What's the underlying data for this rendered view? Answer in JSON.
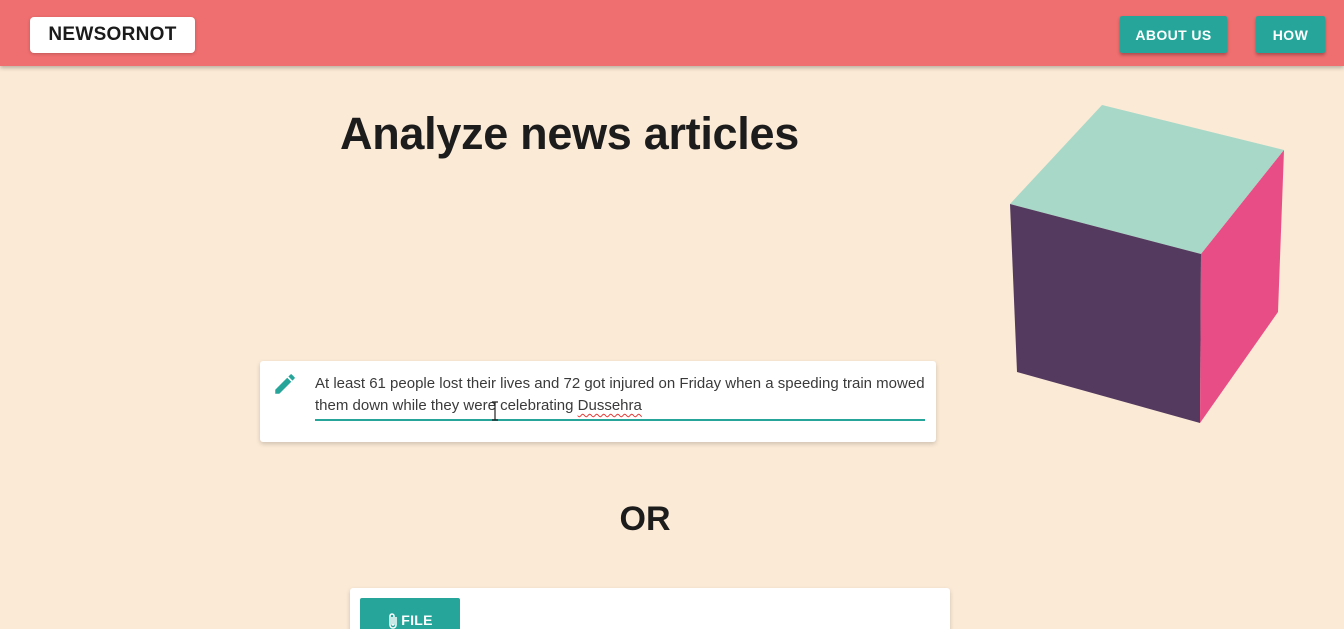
{
  "navbar": {
    "logo": "NEWSORNOT",
    "about_label": "ABOUT US",
    "how_label": "HOW"
  },
  "main": {
    "title": "Analyze news articles",
    "article_input": {
      "value_part1": "At least 61 people lost their lives and 72 got injured on Friday when a speeding train mowed them down while they were celebrating ",
      "value_misspelled": "Dussehra",
      "icon": "pencil-icon"
    },
    "or_label": "OR",
    "file_button_label": "FILE",
    "file_icon": "paperclip-icon"
  },
  "colors": {
    "navbar": "#ef6e6f",
    "background": "#fbead6",
    "accent": "#26a69a",
    "cube_top": "#a8d8c8",
    "cube_front": "#543a5f",
    "cube_side": "#e84d85"
  }
}
